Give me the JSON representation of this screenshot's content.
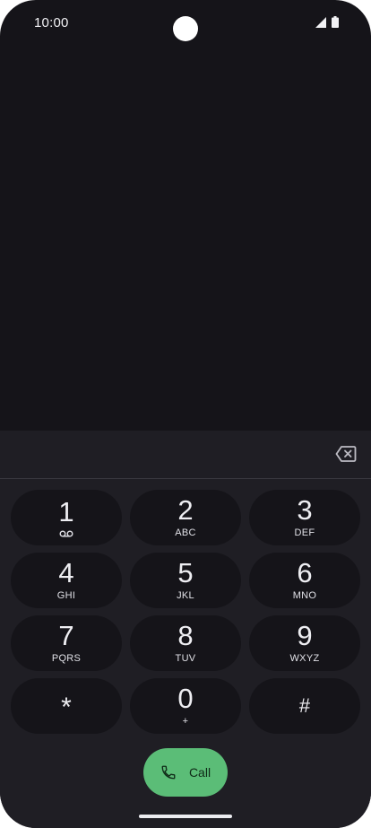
{
  "status_bar": {
    "time": "10:00",
    "icons": [
      "signal-icon",
      "battery-icon"
    ]
  },
  "dialer": {
    "number_value": "",
    "backspace_icon": "backspace-icon",
    "keys": [
      {
        "digit": "1",
        "letters": "",
        "icon": "voicemail-icon"
      },
      {
        "digit": "2",
        "letters": "ABC"
      },
      {
        "digit": "3",
        "letters": "DEF"
      },
      {
        "digit": "4",
        "letters": "GHI"
      },
      {
        "digit": "5",
        "letters": "JKL"
      },
      {
        "digit": "6",
        "letters": "MNO"
      },
      {
        "digit": "7",
        "letters": "PQRS"
      },
      {
        "digit": "8",
        "letters": "TUV"
      },
      {
        "digit": "9",
        "letters": "WXYZ"
      },
      {
        "digit": "*",
        "letters": ""
      },
      {
        "digit": "0",
        "letters": "+"
      },
      {
        "digit": "#",
        "letters": ""
      }
    ],
    "call_button": {
      "label": "Call",
      "icon": "phone-icon"
    }
  },
  "colors": {
    "background": "#151419",
    "panel": "#1f1e24",
    "call_green": "#5bbd77"
  }
}
